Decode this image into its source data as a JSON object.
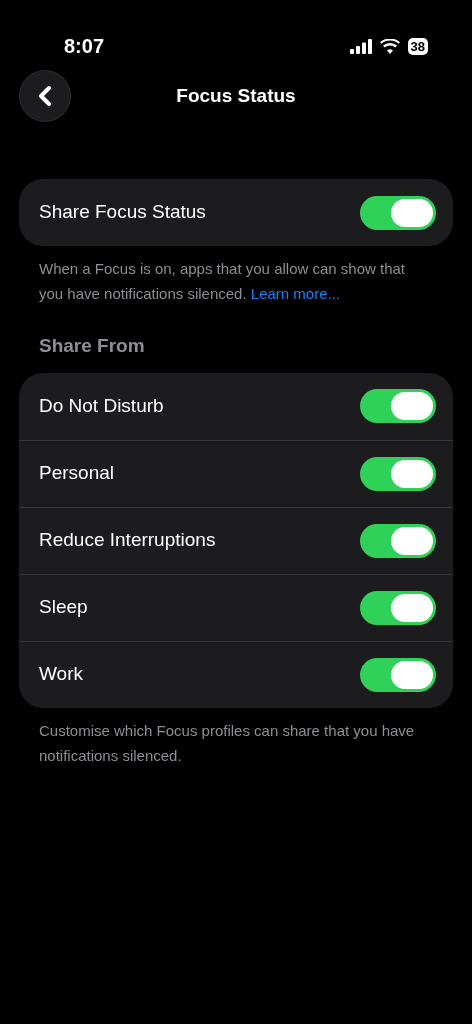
{
  "status_bar": {
    "time": "8:07",
    "battery": "38"
  },
  "header": {
    "title": "Focus Status"
  },
  "share_toggle": {
    "label": "Share Focus Status",
    "on": true
  },
  "share_note": {
    "text": "When a Focus is on, apps that you allow can show that you have notifications silenced.",
    "link": "Learn more..."
  },
  "share_from": {
    "heading": "Share From",
    "items": [
      {
        "label": "Do Not Disturb",
        "on": true
      },
      {
        "label": "Personal",
        "on": true
      },
      {
        "label": "Reduce Interruptions",
        "on": true
      },
      {
        "label": "Sleep",
        "on": true
      },
      {
        "label": "Work",
        "on": true
      }
    ],
    "footer": "Customise which Focus profiles can share that you have notifications silenced."
  }
}
